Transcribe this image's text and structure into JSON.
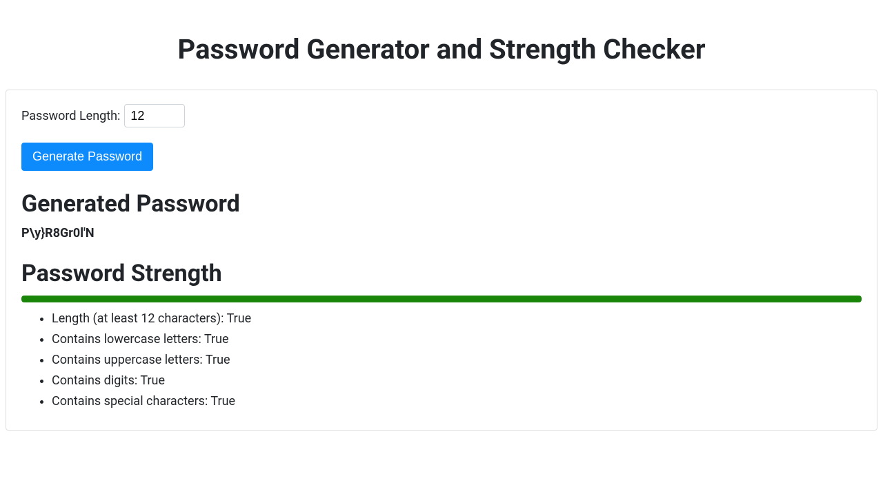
{
  "title": "Password Generator and Strength Checker",
  "form": {
    "length_label": "Password Length:",
    "length_value": "12",
    "generate_button": "Generate Password"
  },
  "output": {
    "heading": "Generated Password",
    "value": "P\\y}R8Gr0l'N"
  },
  "strength": {
    "heading": "Password Strength",
    "percent": 100,
    "bar_color": "#198609",
    "criteria": [
      "Length (at least 12 characters): True",
      "Contains lowercase letters: True",
      "Contains uppercase letters: True",
      "Contains digits: True",
      "Contains special characters: True"
    ]
  }
}
